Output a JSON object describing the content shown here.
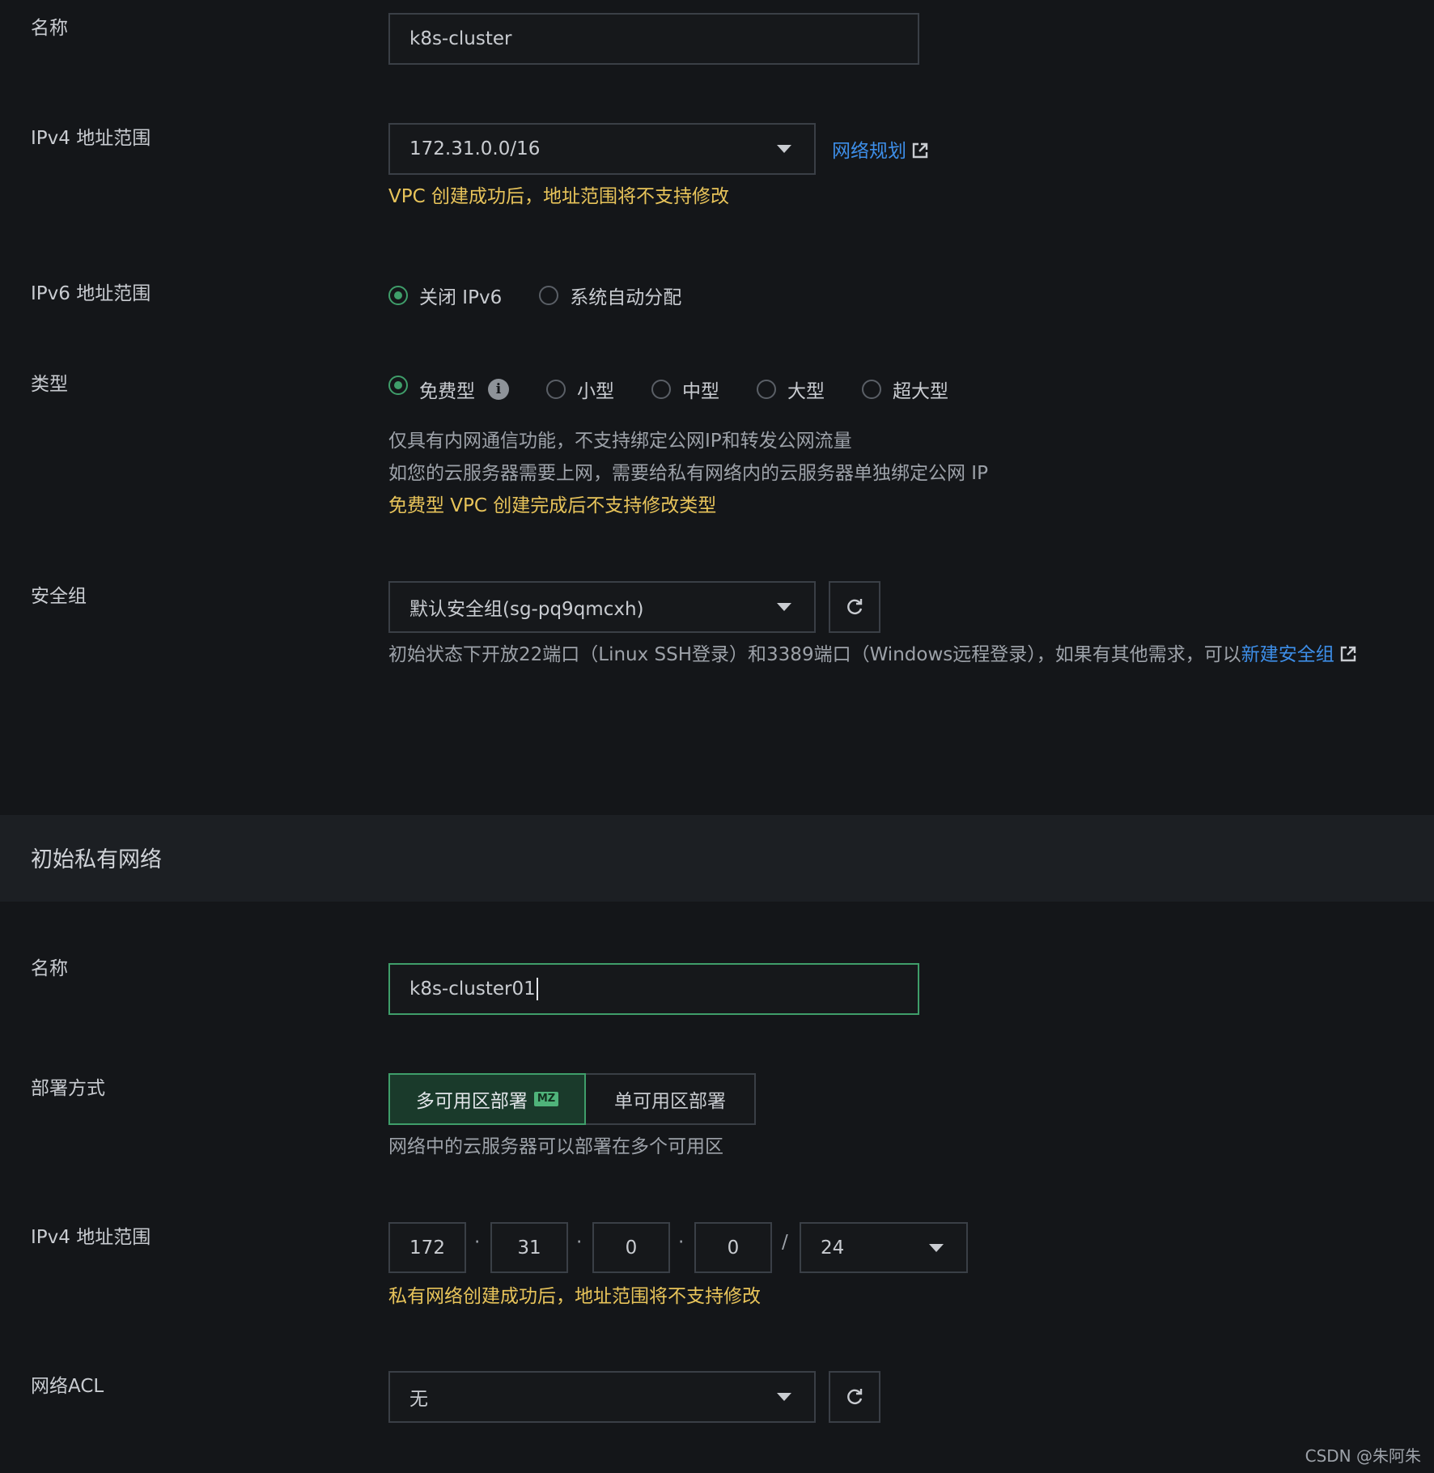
{
  "vpc": {
    "name_label": "名称",
    "name_value": "k8s-cluster",
    "ipv4_label": "IPv4 地址范围",
    "ipv4_value": "172.31.0.0/16",
    "network_planning_link": "网络规划",
    "ipv4_warning": "VPC 创建成功后，地址范围将不支持修改",
    "ipv6_label": "IPv6 地址范围",
    "ipv6_options": [
      "关闭 IPv6",
      "系统自动分配"
    ],
    "ipv6_selected": "关闭 IPv6",
    "type_label": "类型",
    "type_options": [
      "免费型",
      "小型",
      "中型",
      "大型",
      "超大型"
    ],
    "type_selected": "免费型",
    "type_desc_1": "仅具有内网通信功能，不支持绑定公网IP和转发公网流量",
    "type_desc_2": "如您的云服务器需要上网，需要给私有网络内的云服务器单独绑定公网 IP",
    "type_warning": "免费型 VPC 创建完成后不支持修改类型",
    "sg_label": "安全组",
    "sg_value": "默认安全组(sg-pq9qmcxh)",
    "sg_desc": "初始状态下开放22端口（Linux SSH登录）和3389端口（Windows远程登录），如果有其他需求，可以",
    "sg_new_link": "新建安全组"
  },
  "subnet": {
    "section_title": "初始私有网络",
    "name_label": "名称",
    "name_value": "k8s-cluster01",
    "deploy_label": "部署方式",
    "deploy_options": [
      "多可用区部署",
      "单可用区部署"
    ],
    "deploy_badge": "MZ",
    "deploy_selected": "多可用区部署",
    "deploy_desc": "网络中的云服务器可以部署在多个可用区",
    "ipv4_label": "IPv4 地址范围",
    "octets": [
      "172",
      "31",
      "0",
      "0"
    ],
    "octet_sep": "·",
    "mask_sep": "/",
    "mask": "24",
    "ipv4_warning": "私有网络创建成功后，地址范围将不支持修改",
    "acl_label": "网络ACL",
    "acl_value": "无"
  },
  "watermark": "CSDN @朱阿朱",
  "colors": {
    "accent": "#3f9e6a",
    "warning": "#e8c45a",
    "link": "#3d8ee8",
    "background": "#141619"
  }
}
